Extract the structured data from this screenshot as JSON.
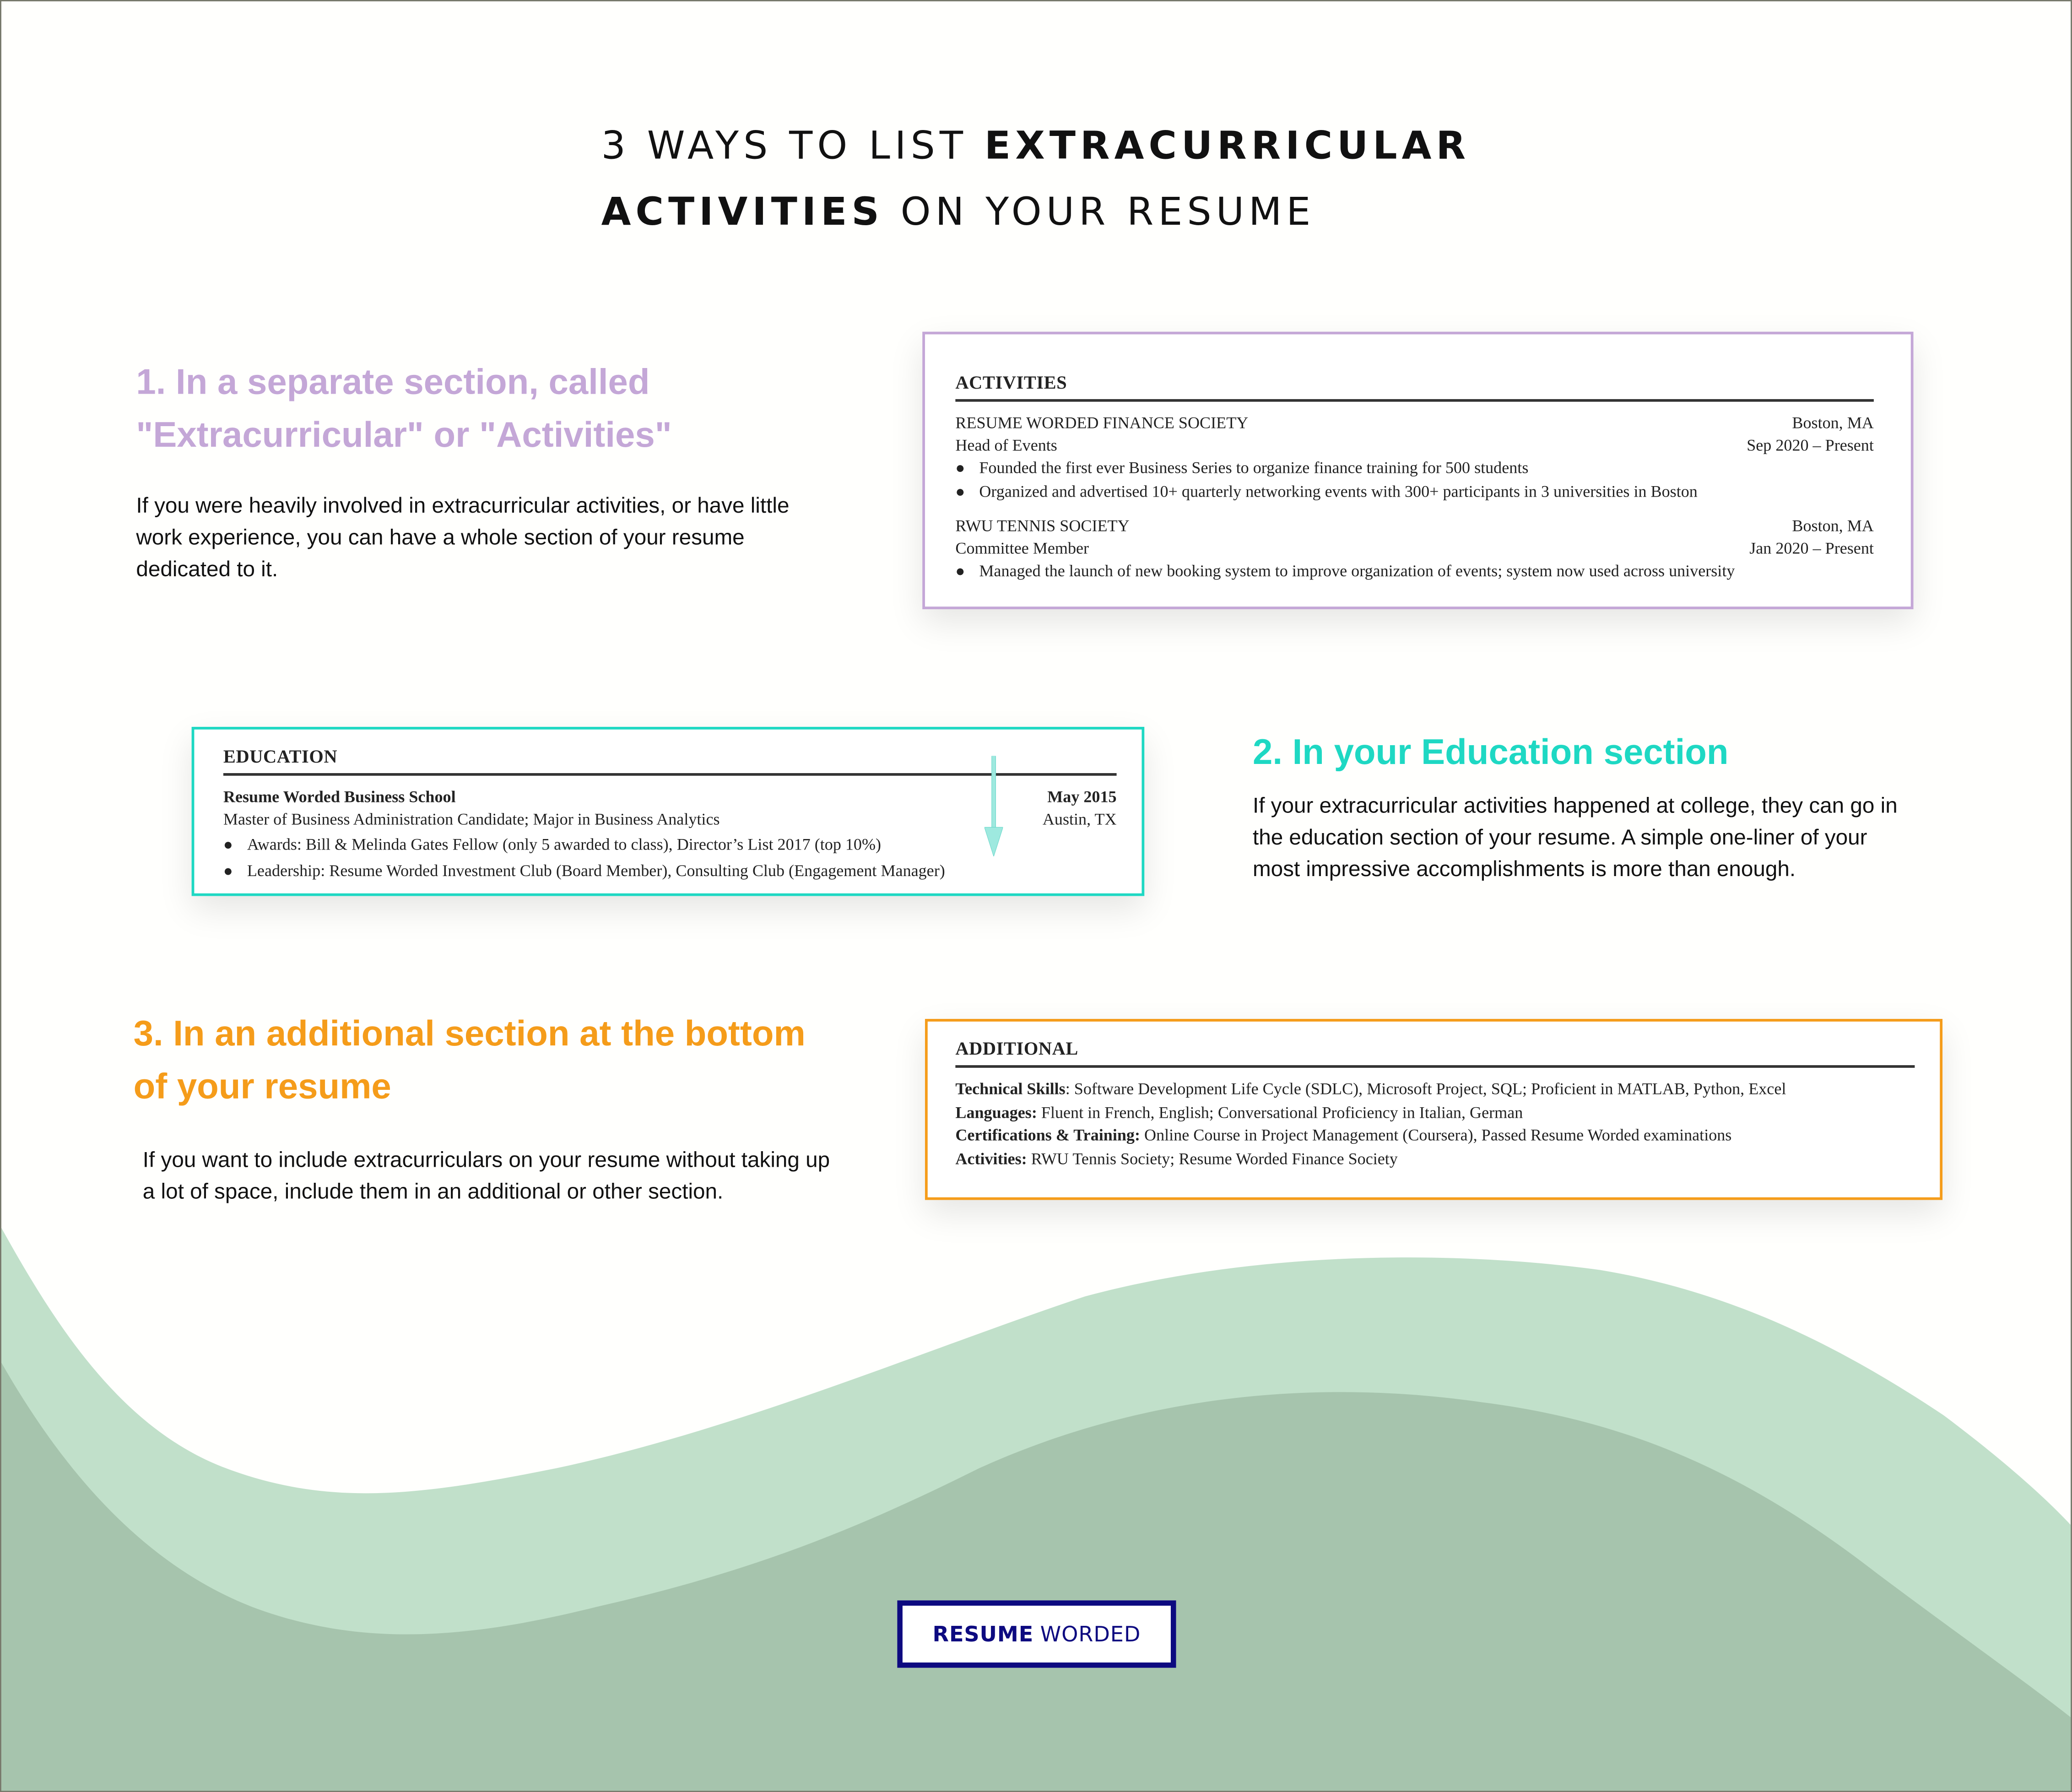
{
  "title": {
    "line1_regular": "3 WAYS TO LIST ",
    "line1_bold": "EXTRACURRICULAR",
    "line2_bold": "ACTIVITIES",
    "line2_regular": " ON YOUR RESUME"
  },
  "colors": {
    "purple": "#c4a7d7",
    "teal": "#1ed8c3",
    "orange": "#f59c1a",
    "wave_light": "#c1e0ca",
    "wave_dark": "#a6c4ad",
    "logo_navy": "#0d0a80",
    "outer_border": "#76786a"
  },
  "methods": [
    {
      "heading_line1": "1. In a separate section, called",
      "heading_line2": "\"Extracurricular\" or \"Activities\"",
      "description": "If you were heavily involved in extracurricular activities, or have little work experience, you can have a whole section of your resume dedicated to it."
    },
    {
      "heading_line1": "2. In your Education section",
      "description": "If your extracurricular activities happened at college, they can go in the education section of your resume. A simple one-liner of your most impressive accomplishments is more than enough."
    },
    {
      "heading_line1": "3. In an additional section at the bottom",
      "heading_line2": "of your resume",
      "description": "If you want to include extracurriculars on your resume without taking up a lot of space, include them in an additional or other section."
    }
  ],
  "activities_card": {
    "section_title": "ACTIVITIES",
    "entries": [
      {
        "org": "RESUME WORDED FINANCE SOCIETY",
        "location": "Boston, MA",
        "role": "Head of Events",
        "dates": "Sep 2020 – Present",
        "bullets": [
          "Founded the first ever Business Series to organize finance training for 500 students",
          "Organized and advertised 10+ quarterly networking events with 300+ participants in 3 universities in Boston"
        ]
      },
      {
        "org": "RWU TENNIS SOCIETY",
        "location": "Boston, MA",
        "role": "Committee Member",
        "dates": "Jan 2020 – Present",
        "bullets": [
          "Managed the launch of new booking system to improve organization of events; system now used across university"
        ]
      }
    ]
  },
  "education_card": {
    "section_title": "EDUCATION",
    "school": "Resume Worded Business School",
    "date": "May 2015",
    "degree": "Master of Business Administration Candidate; Major in Business Analytics",
    "location": "Austin, TX",
    "bullets": [
      "Awards: Bill & Melinda Gates Fellow (only 5 awarded to class), Director’s List 2017 (top 10%)",
      "Leadership: Resume Worded Investment Club (Board Member), Consulting Club (Engagement Manager)"
    ],
    "annotation_icon": "arrow-down-icon"
  },
  "additional_card": {
    "section_title": "ADDITIONAL",
    "items": [
      {
        "label": "Technical Skills",
        "sep": ": ",
        "value": "Software Development Life Cycle (SDLC), Microsoft Project, SQL; Proficient in MATLAB, Python, Excel"
      },
      {
        "label": "Languages:",
        "sep": " ",
        "value": "Fluent in French, English; Conversational Proficiency in Italian, German"
      },
      {
        "label": "Certifications & Training:",
        "sep": " ",
        "value": "Online Course in Project Management (Coursera), Passed Resume Worded examinations"
      },
      {
        "label": "Activities:",
        "sep": " ",
        "value": "RWU Tennis Society; Resume Worded Finance Society"
      }
    ]
  },
  "logo": {
    "bold": "RESUME",
    "regular": "WORDED"
  }
}
